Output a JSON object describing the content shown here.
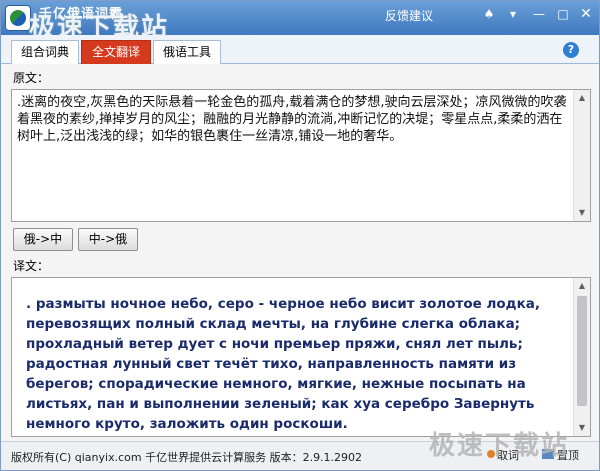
{
  "window": {
    "title": "千亿俄语词霸",
    "watermark": "极速下载站",
    "feedback": "反馈建议",
    "icons": {
      "skin": "shirt-icon",
      "menu": "menu-icon",
      "minimize": "minimize-icon",
      "maximize": "maximize-icon",
      "close": "close-icon"
    }
  },
  "tabs": [
    {
      "label": "组合词典",
      "active": false
    },
    {
      "label": "全文翻译",
      "active": true
    },
    {
      "label": "俄语工具",
      "active": false
    }
  ],
  "help": "?",
  "source": {
    "label": "原文：",
    "text": ".迷离的夜空,灰黑色的天际悬着一轮金色的孤舟,载着满仓的梦想,驶向云层深处；凉风微微的吹袭着黑夜的素纱,掸掉岁月的风尘；融融的月光静静的流淌,冲断记忆的决堤；零星点点,柔柔的洒在树叶上,泛出浅浅的绿；如华的银色裹住一丝清凉,铺设一地的奢华。"
  },
  "buttons": {
    "ru_to_zh": "俄->中",
    "zh_to_ru": "中->俄"
  },
  "translation": {
    "label": "译文：",
    "text": ". размыты ночное небо, серо - черное небо висит золотое лодка, перевозящих полный склад мечты, на глубине слегка облака; прохладный ветер дует с ночи премьер пряжи, снял лет пыль; радостная лунный свет течёт тихо, направленность памяти из берегов; спорадические немного, мягкие, нежные посыпать на листьях, пан и выполнении зеленый; как хуа серебро Завернуть немного круто, заложить один роскоши."
  },
  "status": {
    "text": "版权所有(C) qianyix.com 千亿世界提供云计算服务 版本：2.9.1.2902",
    "cancel": "取词",
    "top": "置顶",
    "watermark": "极速下载站"
  },
  "colors": {
    "titlebar": "#3f78bf",
    "active_tab": "#d63a1e",
    "translation_text": "#1a2b6b"
  }
}
